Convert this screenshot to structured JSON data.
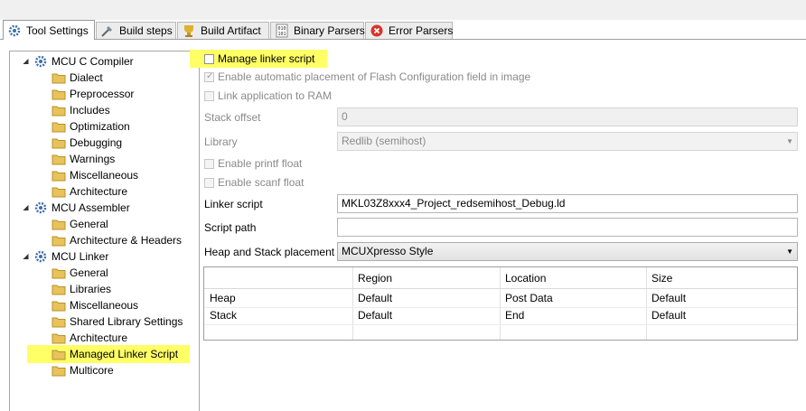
{
  "tabs": [
    {
      "label": "Tool Settings",
      "icon": "tool-settings-icon",
      "active": true
    },
    {
      "label": "Build steps",
      "icon": "build-steps-icon"
    },
    {
      "label": "Build Artifact",
      "icon": "build-artifact-icon"
    },
    {
      "label": "Binary Parsers",
      "icon": "binary-parsers-icon"
    },
    {
      "label": "Error Parsers",
      "icon": "error-parsers-icon"
    }
  ],
  "tree": {
    "compiler": {
      "label": "MCU C Compiler",
      "children": [
        "Dialect",
        "Preprocessor",
        "Includes",
        "Optimization",
        "Debugging",
        "Warnings",
        "Miscellaneous",
        "Architecture"
      ]
    },
    "assembler": {
      "label": "MCU Assembler",
      "children": [
        "General",
        "Architecture & Headers"
      ]
    },
    "linker": {
      "label": "MCU Linker",
      "children": [
        "General",
        "Libraries",
        "Miscellaneous",
        "Shared Library Settings",
        "Architecture",
        "Managed Linker Script",
        "Multicore"
      ]
    },
    "selected": "Managed Linker Script"
  },
  "settings": {
    "manage_linker_script": "Manage linker script",
    "enable_auto_placement": "Enable automatic placement of Flash Configuration field in image",
    "link_to_ram": "Link application to RAM",
    "stack_offset_label": "Stack offset",
    "stack_offset_value": "0",
    "library_label": "Library",
    "library_value": "Redlib (semihost)",
    "enable_printf_float": "Enable printf float",
    "enable_scanf_float": "Enable scanf float",
    "linker_script_label": "Linker script",
    "linker_script_value": "MKL03Z8xxx4_Project_redsemihost_Debug.ld",
    "script_path_label": "Script path",
    "script_path_value": "",
    "heap_stack_label": "Heap and Stack placement",
    "heap_stack_value": "MCUXpresso Style"
  },
  "table": {
    "headers": [
      "",
      "Region",
      "Location",
      "Size"
    ],
    "rows": [
      [
        "Heap",
        "Default",
        "Post Data",
        "Default"
      ],
      [
        "Stack",
        "Default",
        "End",
        "Default"
      ]
    ]
  },
  "colors": {
    "highlight": "#ffff66",
    "error_icon": "#d9322b",
    "gear": "#3c6ea8",
    "folder": "#e8c25a"
  }
}
